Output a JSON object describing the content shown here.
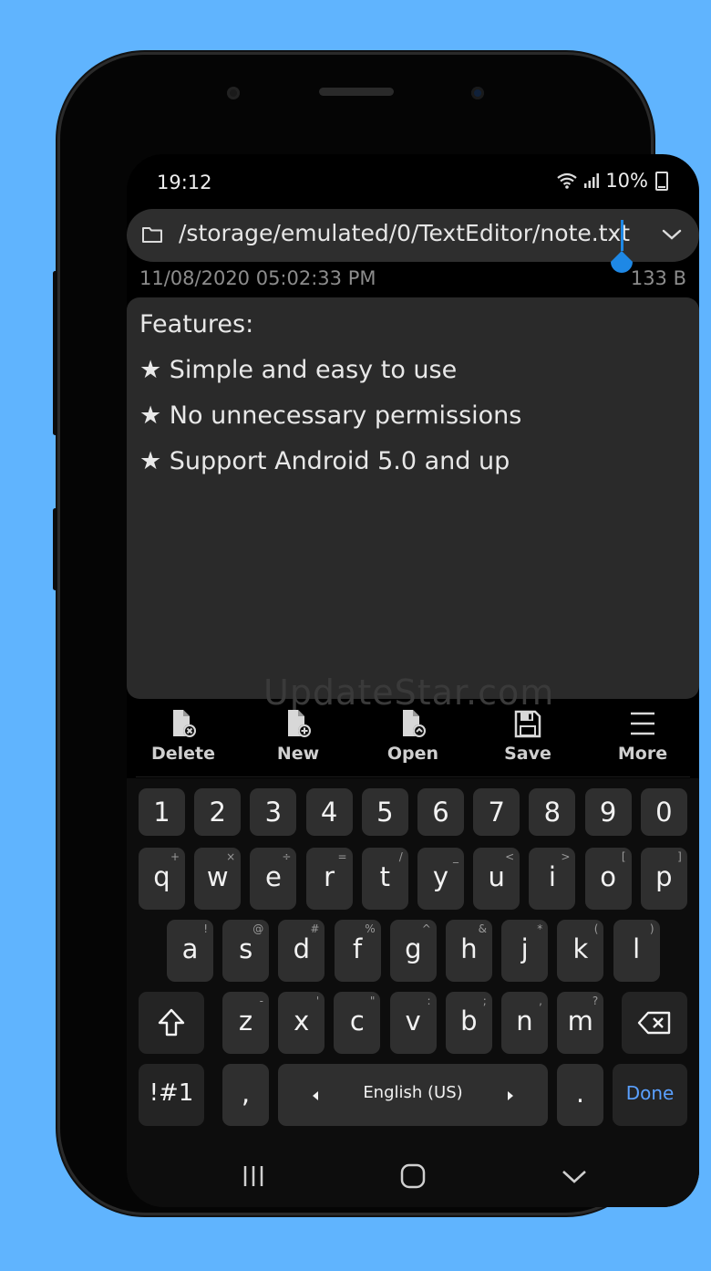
{
  "status": {
    "time": "19:12",
    "battery": "10%"
  },
  "path": {
    "text": "/storage/emulated/0/TextEditor/note.txt"
  },
  "meta": {
    "date": "11/08/2020 05:02:33 PM",
    "size": "133 B"
  },
  "editor": {
    "lines": [
      "Features:",
      "★ Simple and easy to use",
      "★ No unnecessary permissions",
      "★ Support Android 5.0 and up"
    ]
  },
  "watermark": "UpdateStar.com",
  "toolbar": {
    "delete": "Delete",
    "new": "New",
    "open": "Open",
    "save": "Save",
    "more": "More"
  },
  "keyboard": {
    "numbers": [
      "1",
      "2",
      "3",
      "4",
      "5",
      "6",
      "7",
      "8",
      "9",
      "0"
    ],
    "row1": [
      {
        "k": "q",
        "s": "+"
      },
      {
        "k": "w",
        "s": "×"
      },
      {
        "k": "e",
        "s": "÷"
      },
      {
        "k": "r",
        "s": "="
      },
      {
        "k": "t",
        "s": "/"
      },
      {
        "k": "y",
        "s": "_"
      },
      {
        "k": "u",
        "s": "<"
      },
      {
        "k": "i",
        "s": ">"
      },
      {
        "k": "o",
        "s": "["
      },
      {
        "k": "p",
        "s": "]"
      }
    ],
    "row2": [
      {
        "k": "a",
        "s": "!"
      },
      {
        "k": "s",
        "s": "@"
      },
      {
        "k": "d",
        "s": "#"
      },
      {
        "k": "f",
        "s": "%"
      },
      {
        "k": "g",
        "s": "^"
      },
      {
        "k": "h",
        "s": "&"
      },
      {
        "k": "j",
        "s": "*"
      },
      {
        "k": "k",
        "s": "("
      },
      {
        "k": "l",
        "s": ")"
      }
    ],
    "row3": [
      {
        "k": "z",
        "s": "-"
      },
      {
        "k": "x",
        "s": "'"
      },
      {
        "k": "c",
        "s": "\""
      },
      {
        "k": "v",
        "s": ":"
      },
      {
        "k": "b",
        "s": ";"
      },
      {
        "k": "n",
        "s": ","
      },
      {
        "k": "m",
        "s": "?"
      }
    ],
    "symbols": "!#1",
    "comma": ",",
    "space": "English (US)",
    "period": ".",
    "done": "Done"
  },
  "colors": {
    "accent": "#1e88e5",
    "done": "#5aa0ff",
    "background": "#60b4fe"
  }
}
